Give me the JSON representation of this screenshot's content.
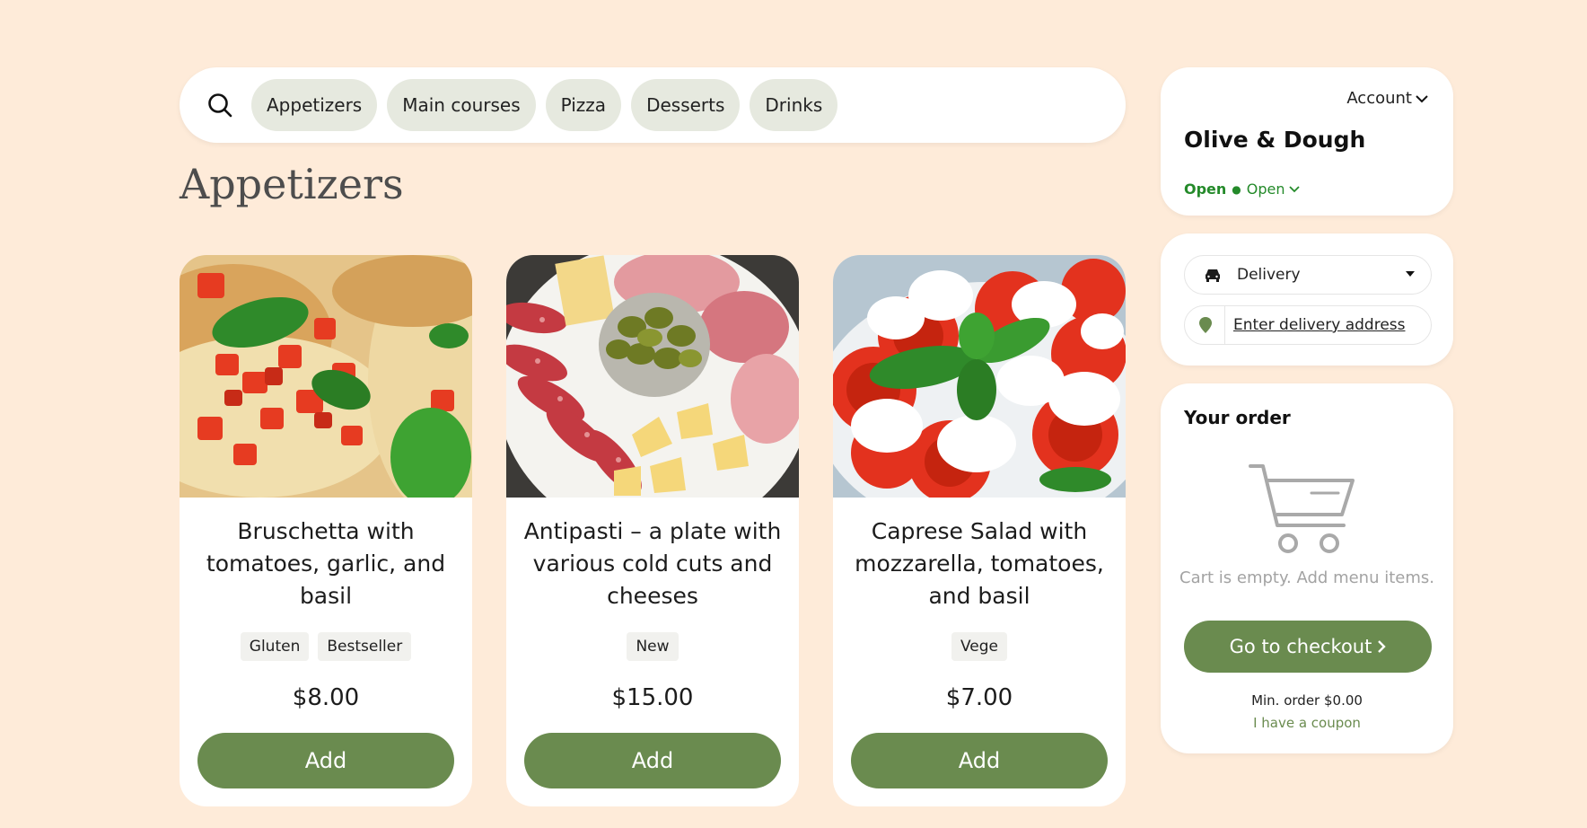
{
  "header": {
    "categories": [
      "Appetizers",
      "Main courses",
      "Pizza",
      "Desserts",
      "Drinks"
    ]
  },
  "section_title": "Appetizers",
  "menu_items": [
    {
      "name": "Bruschetta with tomatoes, garlic, and basil",
      "tags": [
        "Gluten",
        "Bestseller"
      ],
      "price": "$8.00",
      "button": "Add"
    },
    {
      "name": "Antipasti – a plate with various cold cuts and cheeses",
      "tags": [
        "New"
      ],
      "price": "$15.00",
      "button": "Add"
    },
    {
      "name": "Caprese Salad with mozzarella, tomatoes, and basil",
      "tags": [
        "Vege"
      ],
      "price": "$7.00",
      "button": "Add"
    }
  ],
  "restaurant": {
    "account_label": "Account",
    "name": "Olive & Dough",
    "status": "Open",
    "status_select": "Open"
  },
  "delivery": {
    "mode": "Delivery",
    "address_placeholder": "Enter delivery address"
  },
  "order": {
    "title": "Your order",
    "empty_text": "Cart is empty. Add menu items.",
    "checkout_label": "Go to checkout",
    "min_order": "Min. order $0.00",
    "coupon_label": "I have a coupon"
  },
  "colors": {
    "background": "#feebd9",
    "accent_green": "#6a8b4f",
    "status_green": "#248a2a",
    "chip_bg": "#e6e9df"
  },
  "icons": [
    "search-icon",
    "chevron-down-icon",
    "car-icon",
    "location-pin-icon",
    "shopping-cart-icon",
    "chevron-right-icon",
    "caret-down-icon"
  ]
}
